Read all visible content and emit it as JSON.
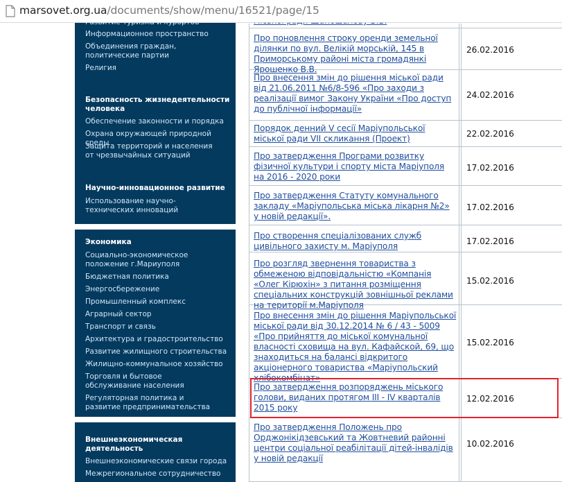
{
  "browser": {
    "url_host": "marsovet.org.ua",
    "url_path": "/documents/show/menu/16521/page/15"
  },
  "sidebar": {
    "partial_top_items": [
      "Развитие туризма и курортов",
      "Информационное пространство",
      "Объединения граждан, политические партии",
      "Религия"
    ],
    "sections": [
      {
        "heading": "Безопасность жизнедеятельности человека",
        "links": [
          "Обеспечение законности и порядка",
          "Охрана окружающей природной среды",
          "Защита территорий и населения от чрезвычайных ситуаций"
        ]
      },
      {
        "heading": "Научно-инновационное развитие",
        "links": [
          "Использование научно-технических инноваций"
        ]
      },
      {
        "heading": "Экономика",
        "links": [
          "Социально-экономическое положение г.Мариуполя",
          "Бюджетная политика",
          "Энергосбережение",
          "Промышленный комплекс",
          "Аграрный сектор",
          "Транспорт и связь",
          "Архитектура и градостроительство",
          "Развитие жилищного строительства",
          "Жилищно-коммунальное хозяйство",
          "Торговля и бытовое обслуживание населения",
          "Регуляторная политика и развитие предпринимательства"
        ]
      },
      {
        "heading": "Внешнеэкономическая деятельность",
        "links": [
          "Внешнеэкономические связи города",
          "Межрегиональное сотрудничество"
        ]
      }
    ]
  },
  "documents": [
    {
      "title": "міської ради Шапошалову В.В.",
      "date": ""
    },
    {
      "title": "Про поновлення строку оренди земельної ділянки по вул. Велікій морській, 145 в Приморському районі міста громадянкі Ярошенко В.В.",
      "date": "26.02.2016"
    },
    {
      "title": "Про внесення змін до рішення міської ради від 21.06.2011 №6/8-596 «Про заходи з реалізації вимог Закону України «Про доступ до публічної інформації»",
      "date": "24.02.2016"
    },
    {
      "title": "Порядок денний V сесії Маріупольської міської ради VII скликання (Проект)",
      "date": "22.02.2016"
    },
    {
      "title": "Про затвердження Програми розвитку фізичної культури і спорту міста Маріуполя на 2016 - 2020 роки",
      "date": "17.02.2016"
    },
    {
      "title": "Про затвердження Статуту комунального закладу «Маріупольська міська лікарня №2» у новій редакції».",
      "date": "17.02.2016"
    },
    {
      "title": "Про створення спеціалізованих служб цивільного захисту м. Маріуполя",
      "date": "17.02.2016"
    },
    {
      "title": "Про розгляд звернення товариства з обмеженою відповідальністю «Компанія «Олег Кірюхін» з питання розміщення спеціальних конструкцій зовнішньої реклами на території м.Маріуполя",
      "date": "15.02.2016"
    },
    {
      "title": "Про внесення змін до рішення Маріупольської міської ради від 30.12.2014 № 6 / 43 - 5009 «Про прийняття до міської комунальної власності сховища на вул. Кафайской, 69, що знаходиться на балансі відкритого акціонерного товариства «Маріупольский хлібокомбінат»",
      "date": "15.02.2016"
    },
    {
      "title": "Про затвердження розпоряджень міського голови, виданих протягом III - IV кварталів 2015 року",
      "date": "12.02.2016"
    },
    {
      "title": "Про затвердження Положень про Орджонікідзевський та Жовтневий районні центри соціальної реабілітації дітей-інвалідів у новій редакції",
      "date": "10.02.2016"
    }
  ],
  "colors": {
    "sidebar_bg": "#053a5f",
    "link_blue": "#1f4e9e",
    "highlight_red": "#e2222b"
  }
}
